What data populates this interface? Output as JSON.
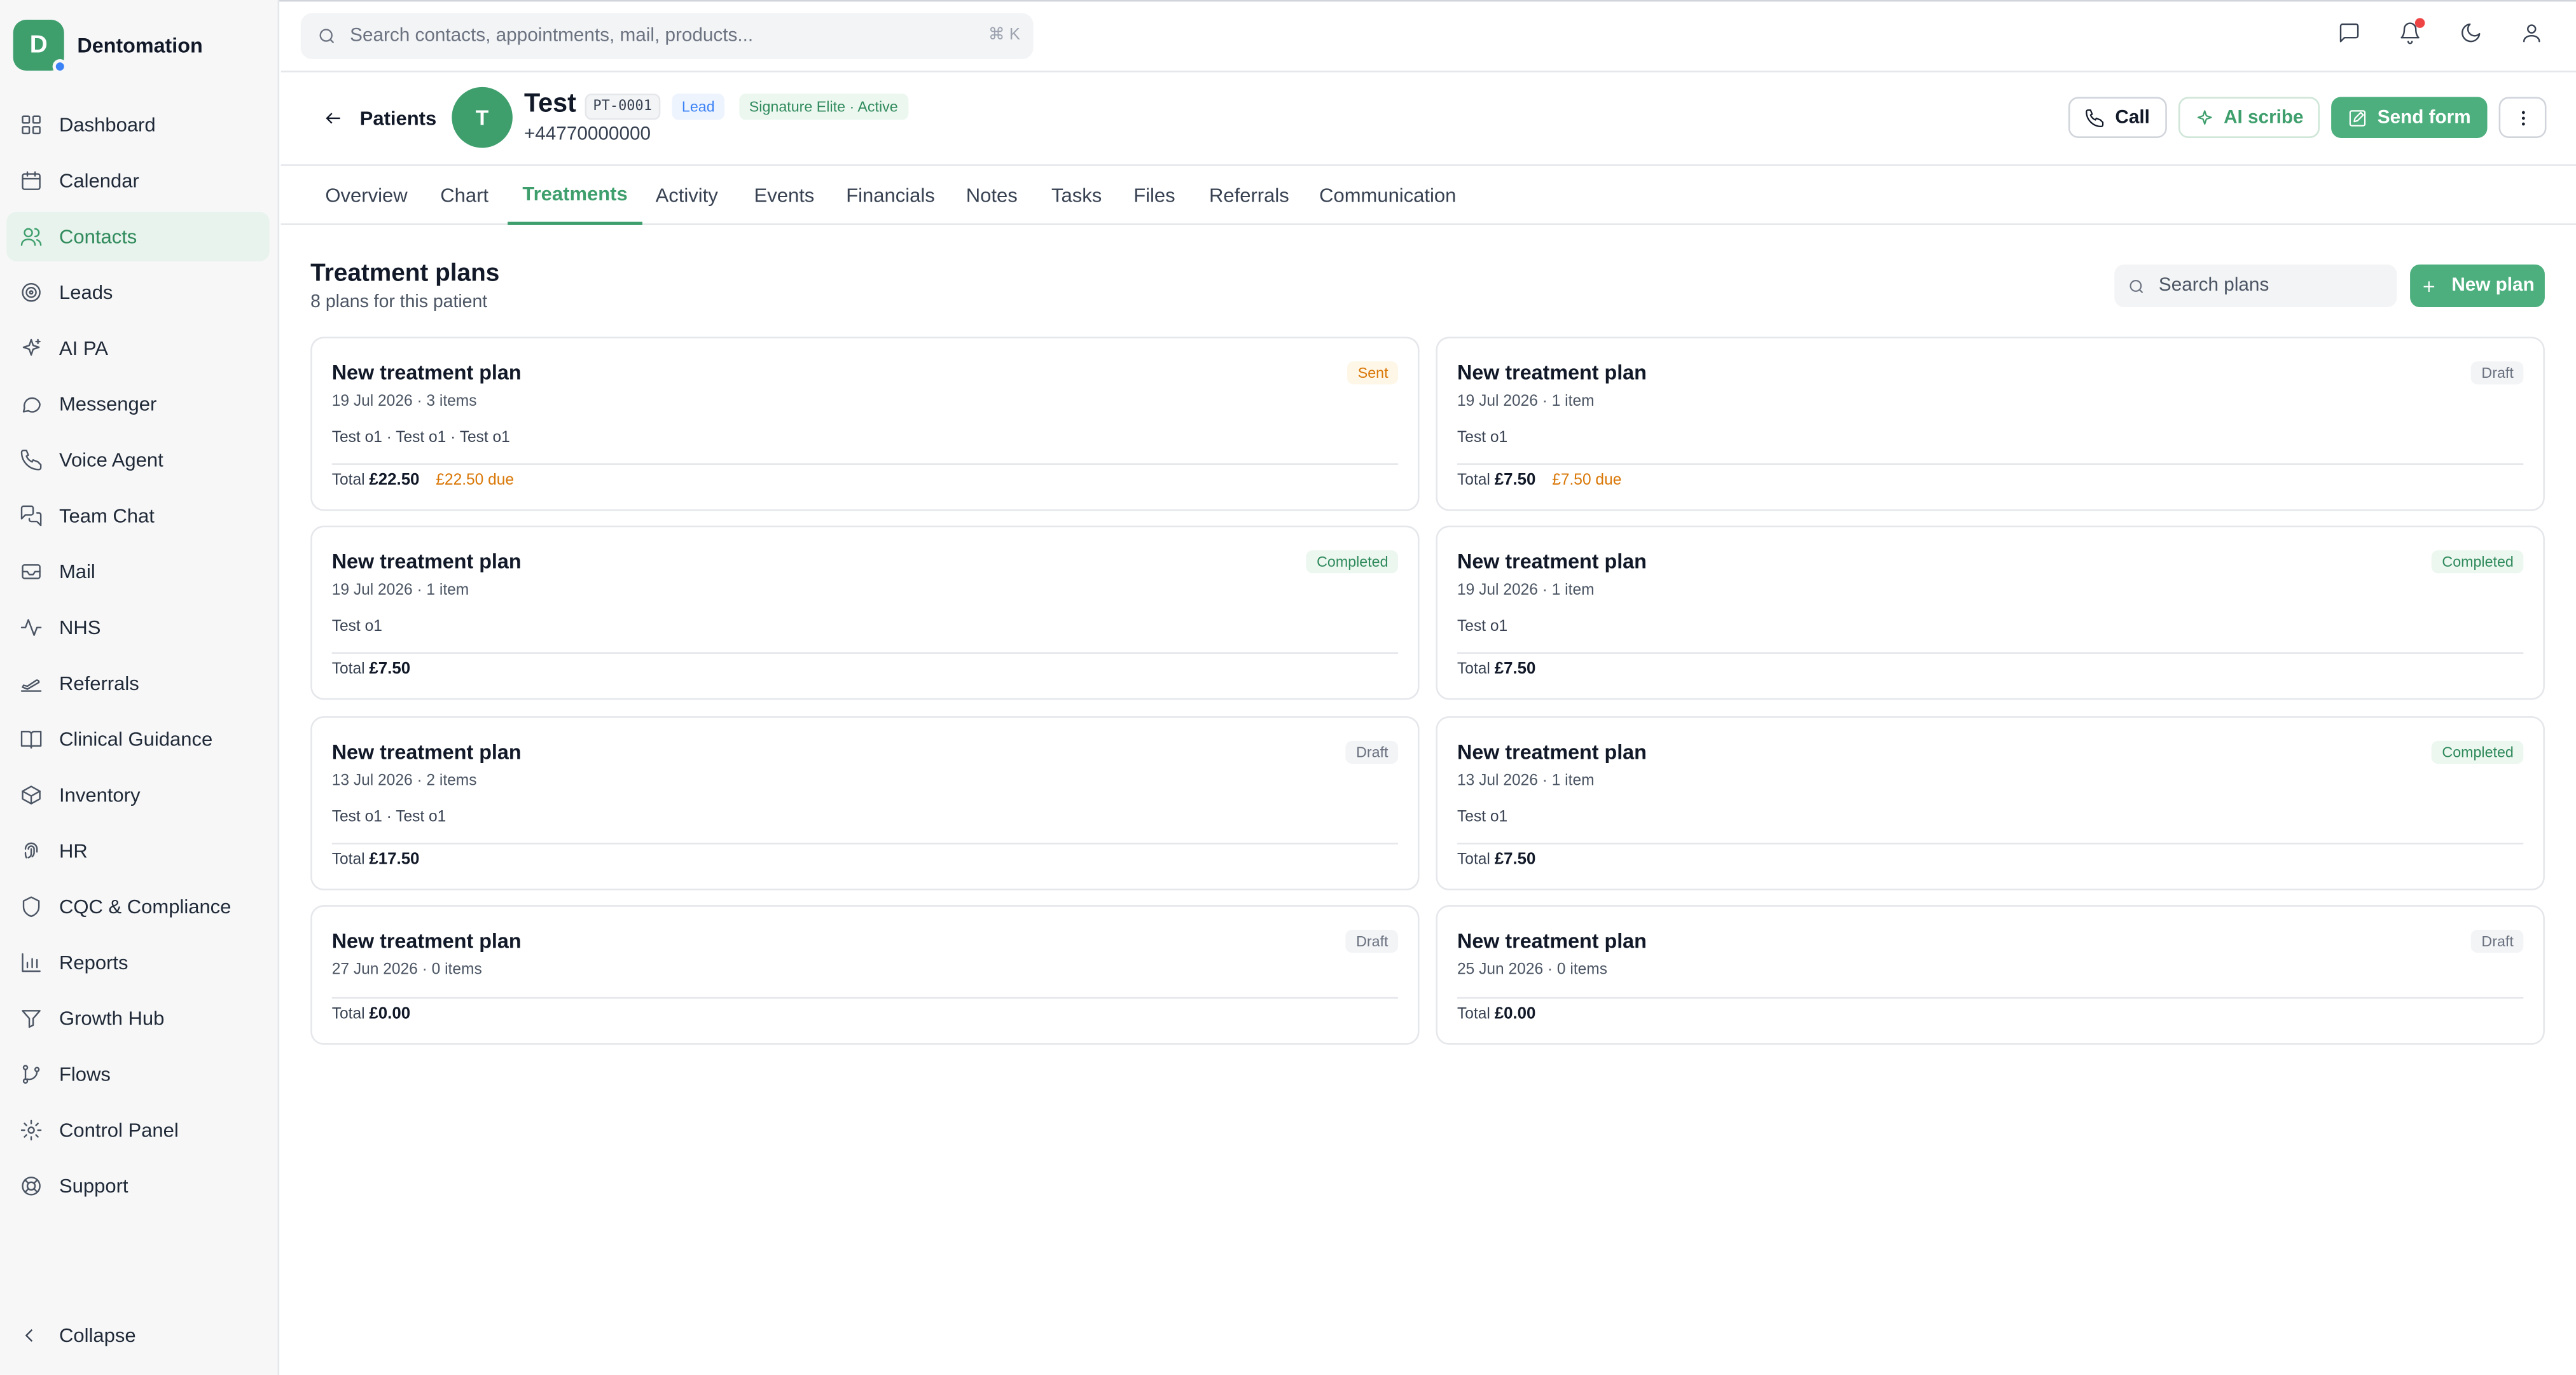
{
  "app": {
    "name": "Dentomation",
    "logo_letter": "D"
  },
  "sidebar": {
    "items": [
      {
        "label": "Dashboard",
        "icon": "grid-icon"
      },
      {
        "label": "Calendar",
        "icon": "calendar-icon"
      },
      {
        "label": "Contacts",
        "icon": "users-icon",
        "active": true
      },
      {
        "label": "Leads",
        "icon": "target-icon"
      },
      {
        "label": "AI PA",
        "icon": "sparkles-icon"
      },
      {
        "label": "Messenger",
        "icon": "message-circle-icon"
      },
      {
        "label": "Voice Agent",
        "icon": "phone-icon"
      },
      {
        "label": "Team Chat",
        "icon": "messages-icon"
      },
      {
        "label": "Mail",
        "icon": "mail-icon"
      },
      {
        "label": "NHS",
        "icon": "activity-icon"
      },
      {
        "label": "Referrals",
        "icon": "plane-icon"
      },
      {
        "label": "Clinical Guidance",
        "icon": "book-icon"
      },
      {
        "label": "Inventory",
        "icon": "box-icon"
      },
      {
        "label": "HR",
        "icon": "fingerprint-icon"
      },
      {
        "label": "CQC & Compliance",
        "icon": "shield-icon"
      },
      {
        "label": "Reports",
        "icon": "bar-chart-icon"
      },
      {
        "label": "Growth Hub",
        "icon": "filter-icon"
      },
      {
        "label": "Flows",
        "icon": "git-branch-icon"
      },
      {
        "label": "Control Panel",
        "icon": "gear-icon"
      },
      {
        "label": "Support",
        "icon": "lifebuoy-icon"
      }
    ],
    "collapse_label": "Collapse"
  },
  "topbar": {
    "search_placeholder": "Search contacts, appointments, mail, products...",
    "shortcut": "⌘ K"
  },
  "patient": {
    "back_label": "Patients",
    "avatar_letter": "T",
    "name": "Test",
    "id": "PT-0001",
    "tag": "Lead",
    "status": "Signature Elite · Active",
    "phone": "+44770000000",
    "actions": {
      "call": "Call",
      "ai_scribe": "AI scribe",
      "send_form": "Send form"
    }
  },
  "tabs": [
    "Overview",
    "Chart",
    "Treatments",
    "Activity",
    "Events",
    "Financials",
    "Notes",
    "Tasks",
    "Files",
    "Referrals",
    "Communication"
  ],
  "active_tab": "Treatments",
  "plans_section": {
    "title": "Treatment plans",
    "subtitle": "8 plans for this patient",
    "search_placeholder": "Search plans",
    "new_plan_label": "New plan"
  },
  "plans": [
    {
      "title": "New treatment plan",
      "meta": "19 Jul 2026 · 3 items",
      "items": "Test o1 · Test o1 · Test o1",
      "total_label": "Total",
      "total": "£22.50",
      "due": "£22.50 due",
      "status": "Sent"
    },
    {
      "title": "New treatment plan",
      "meta": "19 Jul 2026 · 1 item",
      "items": "Test o1",
      "total_label": "Total",
      "total": "£7.50",
      "due": "£7.50 due",
      "status": "Draft"
    },
    {
      "title": "New treatment plan",
      "meta": "19 Jul 2026 · 1 item",
      "items": "Test o1",
      "total_label": "Total",
      "total": "£7.50",
      "due": "",
      "status": "Completed"
    },
    {
      "title": "New treatment plan",
      "meta": "19 Jul 2026 · 1 item",
      "items": "Test o1",
      "total_label": "Total",
      "total": "£7.50",
      "due": "",
      "status": "Completed"
    },
    {
      "title": "New treatment plan",
      "meta": "13 Jul 2026 · 2 items",
      "items": "Test o1 · Test o1",
      "total_label": "Total",
      "total": "£17.50",
      "due": "",
      "status": "Draft"
    },
    {
      "title": "New treatment plan",
      "meta": "13 Jul 2026 · 1 item",
      "items": "Test o1",
      "total_label": "Total",
      "total": "£7.50",
      "due": "",
      "status": "Completed"
    },
    {
      "title": "New treatment plan",
      "meta": "27 Jun 2026 · 0 items",
      "items": "",
      "total_label": "Total",
      "total": "£0.00",
      "due": "",
      "status": "Draft"
    },
    {
      "title": "New treatment plan",
      "meta": "25 Jun 2026 · 0 items",
      "items": "",
      "total_label": "Total",
      "total": "£0.00",
      "due": "",
      "status": "Draft"
    }
  ],
  "colors": {
    "brand": "#3e9f6d",
    "accent_button": "#4caf7d",
    "due": "#d97706",
    "notification": "#ef4444"
  }
}
